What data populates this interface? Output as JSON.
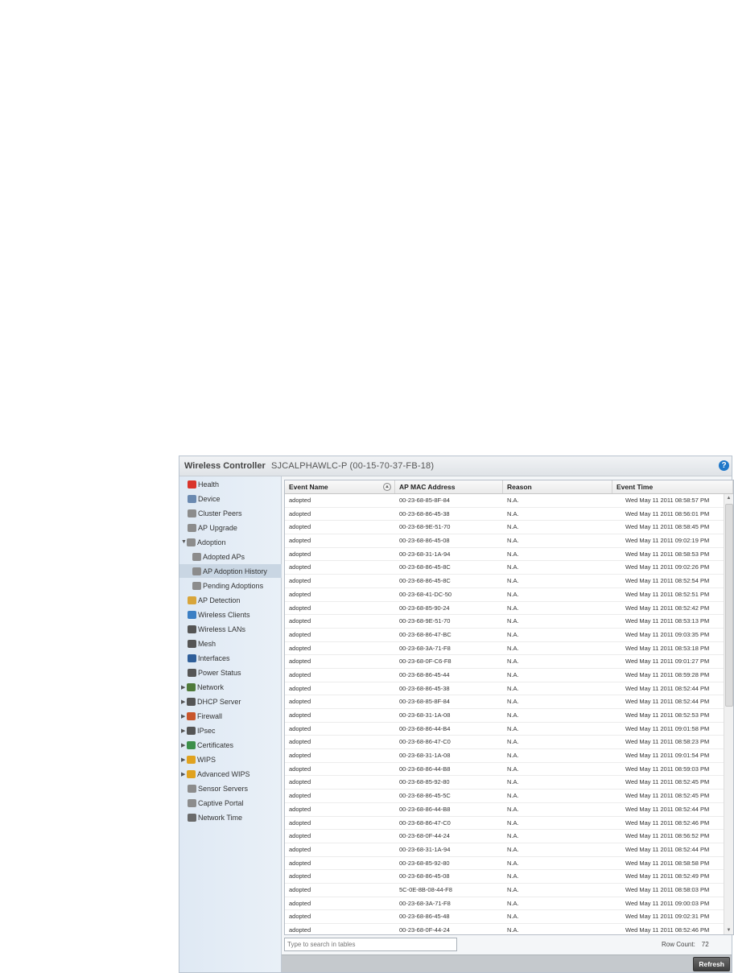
{
  "titlebar": {
    "app_title": "Wireless Controller",
    "host": "SJCALPHAWLC-P (00-15-70-37-FB-18)",
    "help_glyph": "?"
  },
  "sidebar": {
    "items": [
      {
        "label": "Health",
        "icon": "health-icon",
        "color": "#d9342b"
      },
      {
        "label": "Device",
        "icon": "device-icon",
        "color": "#6a89b0"
      },
      {
        "label": "Cluster Peers",
        "icon": "cluster-peers-icon",
        "color": "#8c8c8c"
      },
      {
        "label": "AP Upgrade",
        "icon": "ap-upgrade-icon",
        "color": "#8c8c8c"
      },
      {
        "label": "Adoption",
        "icon": "adoption-icon",
        "color": "#8c8c8c",
        "arrow": "▼"
      },
      {
        "label": "Adopted APs",
        "icon": "adopted-aps-icon",
        "color": "#8c8c8c"
      },
      {
        "label": "AP Adoption History",
        "icon": "ap-adoption-history-icon",
        "color": "#8c8c8c"
      },
      {
        "label": "Pending Adoptions",
        "icon": "pending-adoptions-icon",
        "color": "#8c8c8c"
      },
      {
        "label": "AP Detection",
        "icon": "ap-detection-icon",
        "color": "#d8a53a"
      },
      {
        "label": "Wireless Clients",
        "icon": "wireless-clients-icon",
        "color": "#3b7fc4"
      },
      {
        "label": "Wireless LANs",
        "icon": "wireless-lans-icon",
        "color": "#555555"
      },
      {
        "label": "Mesh",
        "icon": "mesh-icon",
        "color": "#555555"
      },
      {
        "label": "Interfaces",
        "icon": "interfaces-icon",
        "color": "#2f5f9a"
      },
      {
        "label": "Power Status",
        "icon": "power-status-icon",
        "color": "#555555"
      },
      {
        "label": "Network",
        "icon": "network-icon",
        "color": "#4f7a3a",
        "arrow": "▶"
      },
      {
        "label": "DHCP Server",
        "icon": "dhcp-server-icon",
        "color": "#555555",
        "arrow": "▶"
      },
      {
        "label": "Firewall",
        "icon": "firewall-icon",
        "color": "#c8552b",
        "arrow": "▶"
      },
      {
        "label": "IPsec",
        "icon": "ipsec-icon",
        "color": "#555555",
        "arrow": "▶"
      },
      {
        "label": "Certificates",
        "icon": "certificates-icon",
        "color": "#3d8f4a",
        "arrow": "▶"
      },
      {
        "label": "WIPS",
        "icon": "wips-icon",
        "color": "#e0a21f",
        "arrow": "▶"
      },
      {
        "label": "Advanced WIPS",
        "icon": "advanced-wips-icon",
        "color": "#e0a21f",
        "arrow": "▶"
      },
      {
        "label": "Sensor Servers",
        "icon": "sensor-servers-icon",
        "color": "#8c8c8c"
      },
      {
        "label": "Captive Portal",
        "icon": "captive-portal-icon",
        "color": "#8c8c8c"
      },
      {
        "label": "Network Time",
        "icon": "network-time-icon",
        "color": "#6a6a6a"
      }
    ]
  },
  "table": {
    "columns": [
      "Event Name",
      "AP MAC Address",
      "Reason",
      "Event Time"
    ],
    "rows": [
      [
        "adopted",
        "00-23-68-85-8F-84",
        "N.A.",
        "Wed May 11 2011 08:58:57 PM"
      ],
      [
        "adopted",
        "00-23-68-86-45-38",
        "N.A.",
        "Wed May 11 2011 08:56:01 PM"
      ],
      [
        "adopted",
        "00-23-68-9E-51-70",
        "N.A.",
        "Wed May 11 2011 08:58:45 PM"
      ],
      [
        "adopted",
        "00-23-68-86-45-08",
        "N.A.",
        "Wed May 11 2011 09:02:19 PM"
      ],
      [
        "adopted",
        "00-23-68-31-1A-94",
        "N.A.",
        "Wed May 11 2011 08:58:53 PM"
      ],
      [
        "adopted",
        "00-23-68-86-45-8C",
        "N.A.",
        "Wed May 11 2011 09:02:26 PM"
      ],
      [
        "adopted",
        "00-23-68-86-45-8C",
        "N.A.",
        "Wed May 11 2011 08:52:54 PM"
      ],
      [
        "adopted",
        "00-23-68-41-DC-50",
        "N.A.",
        "Wed May 11 2011 08:52:51 PM"
      ],
      [
        "adopted",
        "00-23-68-85-90-24",
        "N.A.",
        "Wed May 11 2011 08:52:42 PM"
      ],
      [
        "adopted",
        "00-23-68-9E-51-70",
        "N.A.",
        "Wed May 11 2011 08:53:13 PM"
      ],
      [
        "adopted",
        "00-23-68-86-47-BC",
        "N.A.",
        "Wed May 11 2011 09:03:35 PM"
      ],
      [
        "adopted",
        "00-23-68-3A-71-F8",
        "N.A.",
        "Wed May 11 2011 08:53:18 PM"
      ],
      [
        "adopted",
        "00-23-68-0F-C6-F8",
        "N.A.",
        "Wed May 11 2011 09:01:27 PM"
      ],
      [
        "adopted",
        "00-23-68-86-45-44",
        "N.A.",
        "Wed May 11 2011 08:59:28 PM"
      ],
      [
        "adopted",
        "00-23-68-86-45-38",
        "N.A.",
        "Wed May 11 2011 08:52:44 PM"
      ],
      [
        "adopted",
        "00-23-68-85-8F-84",
        "N.A.",
        "Wed May 11 2011 08:52:44 PM"
      ],
      [
        "adopted",
        "00-23-68-31-1A-08",
        "N.A.",
        "Wed May 11 2011 08:52:53 PM"
      ],
      [
        "adopted",
        "00-23-68-86-44-B4",
        "N.A.",
        "Wed May 11 2011 09:01:58 PM"
      ],
      [
        "adopted",
        "00-23-68-86-47-C0",
        "N.A.",
        "Wed May 11 2011 08:58:23 PM"
      ],
      [
        "adopted",
        "00-23-68-31-1A-08",
        "N.A.",
        "Wed May 11 2011 09:01:54 PM"
      ],
      [
        "adopted",
        "00-23-68-86-44-B8",
        "N.A.",
        "Wed May 11 2011 08:59:03 PM"
      ],
      [
        "adopted",
        "00-23-68-85-92-80",
        "N.A.",
        "Wed May 11 2011 08:52:45 PM"
      ],
      [
        "adopted",
        "00-23-68-86-45-5C",
        "N.A.",
        "Wed May 11 2011 08:52:45 PM"
      ],
      [
        "adopted",
        "00-23-68-86-44-B8",
        "N.A.",
        "Wed May 11 2011 08:52:44 PM"
      ],
      [
        "adopted",
        "00-23-68-86-47-C0",
        "N.A.",
        "Wed May 11 2011 08:52:46 PM"
      ],
      [
        "adopted",
        "00-23-68-0F-44-24",
        "N.A.",
        "Wed May 11 2011 08:56:52 PM"
      ],
      [
        "adopted",
        "00-23-68-31-1A-94",
        "N.A.",
        "Wed May 11 2011 08:52:44 PM"
      ],
      [
        "adopted",
        "00-23-68-85-92-80",
        "N.A.",
        "Wed May 11 2011 08:58:58 PM"
      ],
      [
        "adopted",
        "00-23-68-86-45-08",
        "N.A.",
        "Wed May 11 2011 08:52:49 PM"
      ],
      [
        "adopted",
        "5C-0E-8B-08-44-F8",
        "N.A.",
        "Wed May 11 2011 08:58:03 PM"
      ],
      [
        "adopted",
        "00-23-68-3A-71-F8",
        "N.A.",
        "Wed May 11 2011 09:00:03 PM"
      ],
      [
        "adopted",
        "00-23-68-86-45-48",
        "N.A.",
        "Wed May 11 2011 09:02:31 PM"
      ],
      [
        "adopted",
        "00-23-68-0F-44-24",
        "N.A.",
        "Wed May 11 2011 08:52:46 PM"
      ],
      [
        "adopted",
        "00-23-68-86-45-5C",
        "N.A.",
        "Wed May 11 2011 08:58:59 PM"
      ],
      [
        "adopted",
        "5C-0E-8B-08-44-F8",
        "N.A.",
        "Wed May 11 2011 09:04:49 PM"
      ]
    ]
  },
  "search": {
    "placeholder": "Type to search in tables"
  },
  "row_count": {
    "label": "Row Count:",
    "value": "72"
  },
  "footer": {
    "refresh_label": "Refresh"
  }
}
